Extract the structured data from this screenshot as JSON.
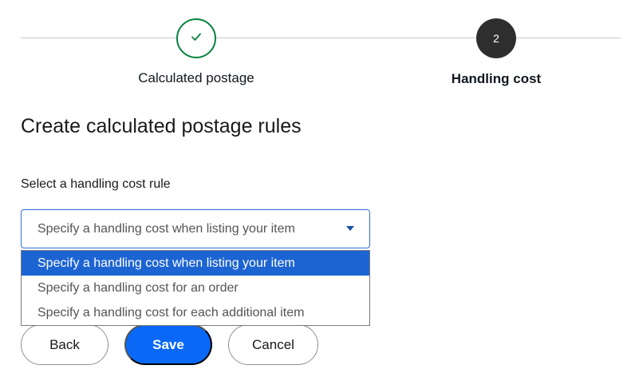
{
  "stepper": {
    "steps": [
      {
        "label": "Calculated postage",
        "state": "completed",
        "icon": "check-icon"
      },
      {
        "label": "Handling cost",
        "number": "2",
        "state": "current"
      }
    ],
    "colors": {
      "completed": "#05823f",
      "current": "#2e2e2e"
    }
  },
  "page": {
    "title": "Create calculated postage rules"
  },
  "handling": {
    "label": "Select a handling cost rule",
    "selected_value": "Specify a handling cost when listing your item",
    "options": [
      "Specify a handling cost when listing your item",
      "Specify a handling cost for an order",
      "Specify a handling cost for each additional item"
    ]
  },
  "actions": {
    "back": "Back",
    "save": "Save",
    "cancel": "Cancel"
  },
  "colors": {
    "primary": "#0968f6",
    "option_highlight": "#1d64d3"
  }
}
